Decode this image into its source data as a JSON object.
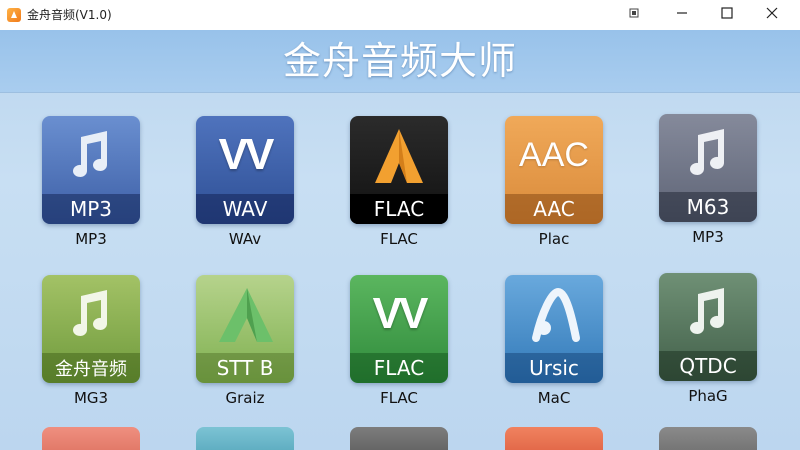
{
  "window": {
    "title": "金舟音频(V1.0)"
  },
  "header": {
    "title": "金舟音频大师"
  },
  "colors": {
    "header_bg": "#a9cdef",
    "content_bg": "#c5dcf0"
  },
  "tiles": [
    {
      "band": "MP3",
      "caption": "MP3",
      "glyph": "music-note-icon",
      "color": "#4a6fb0"
    },
    {
      "band": "WAV",
      "caption": "WAv",
      "glyph": "wave-w-icon",
      "color": "#3e5ea5"
    },
    {
      "band": "FLAC",
      "caption": "FLAC",
      "glyph": "flac-a-icon",
      "color": "#1c1c1c"
    },
    {
      "band": "AAC",
      "caption": "Plac",
      "glyph": "aac-text-icon",
      "color": "#d98a3a"
    },
    {
      "band": "M63",
      "caption": "MP3",
      "glyph": "music-note-icon",
      "color": "#6e7486"
    },
    {
      "band": "金舟音频",
      "caption": "MG3",
      "glyph": "music-note-icon",
      "color": "#7fa845"
    },
    {
      "band": "STT B",
      "caption": "Graiz",
      "glyph": "triangle-a-icon",
      "color": "#8bb85a"
    },
    {
      "band": "FLAC",
      "caption": "FLAC",
      "glyph": "wave-w-icon",
      "color": "#3f9a49"
    },
    {
      "band": "Ursic",
      "caption": "MaC",
      "glyph": "a-swirl-icon",
      "color": "#3e87c4"
    },
    {
      "band": "QTDC",
      "caption": "PhaG",
      "glyph": "music-note-icon",
      "color": "#4e6e55"
    }
  ],
  "partial_tiles": [
    {
      "color": "#e47b6b"
    },
    {
      "color": "#5fb1c6"
    },
    {
      "color": "#6c6c6c"
    },
    {
      "color": "#e4674a"
    },
    {
      "color": "#7a7a7a"
    }
  ]
}
